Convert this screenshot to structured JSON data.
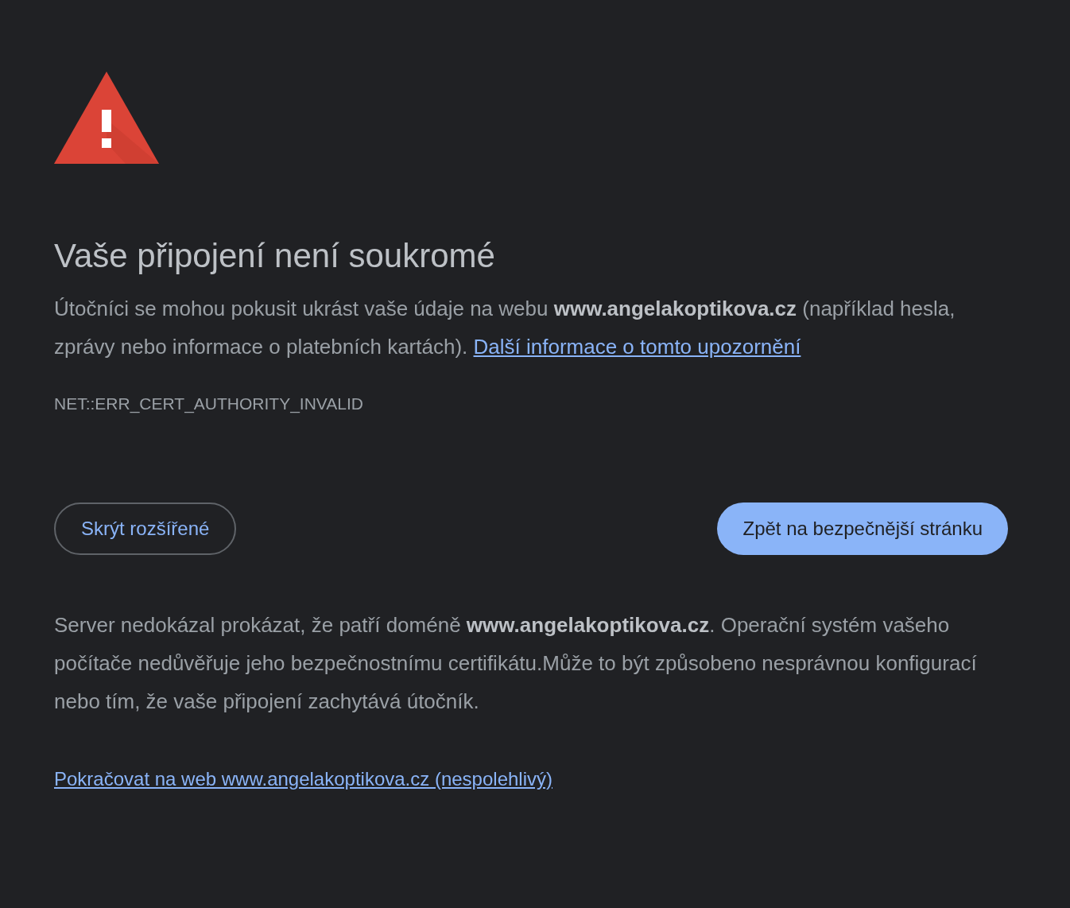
{
  "heading": "Vaše připojení není soukromé",
  "intro": {
    "text": "Útočníci se mohou pokusit ukrást vaše údaje na webu **www.angelakoptikova.cz** (například hesla, zprávy nebo informace o platebních kartách).",
    "link": "Další informace o tomto upozornění"
  },
  "error_code": "NET::ERR_CERT_AUTHORITY_INVALID",
  "buttons": [
    {
      "label": "Skrýt rozšířené",
      "kind": "secondary"
    },
    {
      "label": "Zpět na bezpečnější stránku",
      "kind": "primary"
    }
  ],
  "details": "Server nedokázal prokázat, že patří doméně **www.angelakoptikova.cz**. Operační systém vašeho počítače nedůvěřuje jeho bezpečnostnímu certifikátu.Může to být způsobeno nesprávnou konfigurací nebo tím, že vaše připojení zachytává útočník.",
  "proceed_link": "Pokračovat na web www.angelakoptikova.cz (nespolehlivý)"
}
